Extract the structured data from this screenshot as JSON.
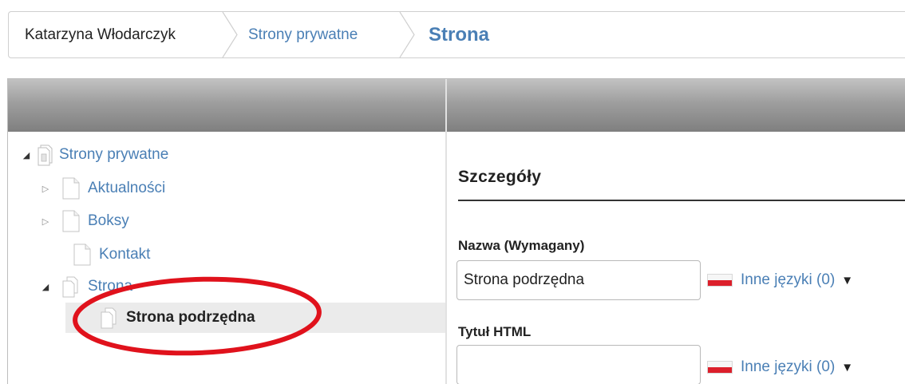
{
  "breadcrumb": {
    "items": [
      {
        "label": "Katarzyna Włodarczyk"
      },
      {
        "label": "Strony prywatne"
      },
      {
        "label": "Strona"
      }
    ]
  },
  "tree": {
    "root": {
      "label": "Strony prywatne",
      "expanded": true
    },
    "items": [
      {
        "label": "Aktualności",
        "expandable": true,
        "expanded": false
      },
      {
        "label": "Boksy",
        "expandable": true,
        "expanded": false
      },
      {
        "label": "Kontakt",
        "expandable": false
      },
      {
        "label": "Strona",
        "expandable": true,
        "expanded": true
      },
      {
        "label": "Strona podrzędna",
        "selected": true
      }
    ]
  },
  "details": {
    "section_title": "Szczegóły",
    "fields": [
      {
        "label": "Nazwa (Wymagany)",
        "value": "Strona podrzędna",
        "lang_link": "Inne języki (0)"
      },
      {
        "label": "Tytuł HTML",
        "value": "",
        "lang_link": "Inne języki (0)"
      }
    ]
  },
  "colors": {
    "link": "#4a7fb5",
    "annotation": "#e0121c",
    "flag_red": "#dc1f2b"
  }
}
